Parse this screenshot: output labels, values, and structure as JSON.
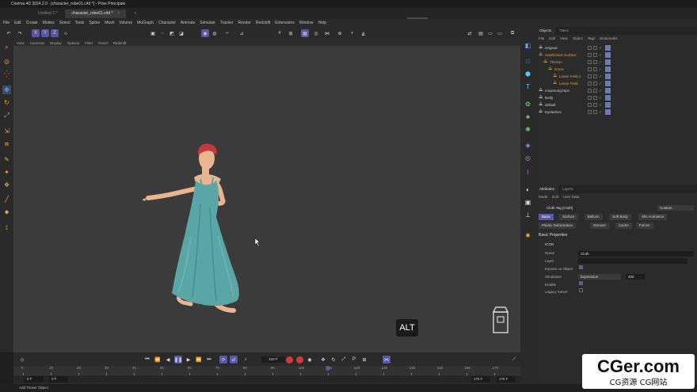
{
  "app": {
    "title": "Cinema 4D 2024.2.0 - [character_robe01.c4d *] - Prise Principale",
    "doc_tabs": [
      {
        "label": "Untitled 2 *",
        "active": false
      },
      {
        "label": "character_robe01.c4d *",
        "active": true
      }
    ],
    "new_tab": "+",
    "layouts": [
      "Startup",
      "Standard",
      "Model",
      "Sculpt",
      "UVEdit",
      "Paint",
      "Groom",
      "Track",
      "Script",
      "Nodes",
      "4S"
    ],
    "active_layout": "Startup"
  },
  "menubar": [
    "File",
    "Edit",
    "Create",
    "Modes",
    "Select",
    "Tools",
    "Spline",
    "Mesh",
    "Volume",
    "MoGraph",
    "Character",
    "Animate",
    "Simulate",
    "Tracker",
    "Render",
    "Redshift",
    "Extensions",
    "Window",
    "Help"
  ],
  "viewport_menu": [
    "View",
    "Cameras",
    "Display",
    "Options",
    "Filter",
    "Panel",
    "Redshift"
  ],
  "overlay": {
    "alt_key": "ALT"
  },
  "timeline": {
    "current_frame": "110 F",
    "ruler_ticks": [
      "0",
      "10",
      "20",
      "30",
      "40",
      "50",
      "60",
      "70",
      "80",
      "90",
      "100",
      "110",
      "120",
      "130",
      "140",
      "150",
      "160",
      "170"
    ],
    "range_start": "0 F",
    "range_start2": "0 F",
    "range_end": "175 F",
    "range_end2": "175 F",
    "playhead_frame": 110
  },
  "status": "Add Tricker Object",
  "objects_panel": {
    "tabs": [
      "Objects",
      "Takes"
    ],
    "menu": [
      "File",
      "Edit",
      "View",
      "Object",
      "Tags",
      "Bookmarks"
    ],
    "rows": [
      {
        "name": "Original",
        "color": "#d0d0d0",
        "indent": 0
      },
      {
        "name": "Subdivision Surface",
        "color": "#d8a046",
        "indent": 0
      },
      {
        "name": "Thicken",
        "color": "#d8a046",
        "indent": 1
      },
      {
        "name": "Dress",
        "color": "#d8a046",
        "indent": 2
      },
      {
        "name": "Linear Field.1",
        "color": "#d8a046",
        "indent": 3
      },
      {
        "name": "Linear Field",
        "color": "#d8a046",
        "indent": 3
      },
      {
        "name": "mixamorig:Hips",
        "color": "#d0d0d0",
        "indent": 0
      },
      {
        "name": "Body",
        "color": "#d0d0d0",
        "indent": 0
      },
      {
        "name": "default",
        "color": "#d0d0d0",
        "indent": 0
      },
      {
        "name": "Eyelashes",
        "color": "#d0d0d0",
        "indent": 0
      }
    ]
  },
  "attributes_panel": {
    "tabs": [
      "Attributes",
      "Layers"
    ],
    "menu": [
      "Mode",
      "Edit",
      "User Data"
    ],
    "tag_title": "Cloth Tag [Cloth]",
    "preset": "Custom",
    "tab_row1": [
      "Basic",
      "Surface",
      "Balloon",
      "Soft Body",
      "Mix Animation"
    ],
    "tab_row2": [
      "Plastic Deformation",
      "Dresser",
      "Cache",
      "Forces"
    ],
    "section": "Basic Properties",
    "icon_label": "ICON",
    "fields": {
      "name_label": "Name",
      "name_value": "Cloth",
      "layer_label": "Layer",
      "expose_label": "Expose on Object",
      "simulation_label": "Simulation",
      "simulation_value": "Expression",
      "simulation_number": "400",
      "enable_label": "Enable",
      "legacy_label": "Legacy Solver"
    }
  },
  "watermark": {
    "line1": "CGer.com",
    "line2": "CG资源 CG网站"
  },
  "colors": {
    "accent": "#5a56a8",
    "viewport": "#3b3b3b",
    "dress": "#5aa5a5",
    "hair": "#c23a3a"
  }
}
